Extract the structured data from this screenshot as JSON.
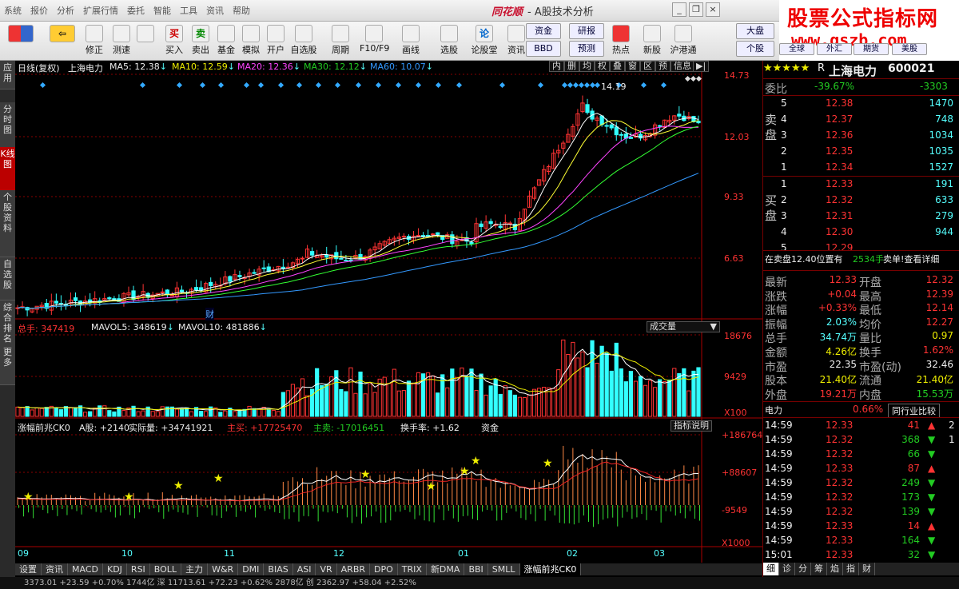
{
  "menu": [
    "系统",
    "报价",
    "分析",
    "扩展行情",
    "委托",
    "智能",
    "工具",
    "资讯",
    "帮助"
  ],
  "app": {
    "logo": "同花顺",
    "title": "- A股技术分析"
  },
  "brand": {
    "line1": "股票公式指标网",
    "line2": "www.gszb.com"
  },
  "toolbar": [
    {
      "label": "",
      "icon": "grid-icon"
    },
    {
      "label": "",
      "icon": "back-arrow-icon"
    },
    {
      "label": "修正",
      "icon": "up-down-icon"
    },
    {
      "label": "测速",
      "icon": "gauge-icon"
    },
    {
      "label": "",
      "icon": "clock-icon"
    },
    {
      "label": "买入",
      "icon": "buy-icon",
      "glyph": "买"
    },
    {
      "label": "卖出",
      "icon": "sell-icon",
      "glyph": "卖"
    },
    {
      "label": "基金",
      "icon": "fund-icon"
    },
    {
      "label": "模拟",
      "icon": "hammer-icon"
    },
    {
      "label": "开户",
      "icon": "lock-icon"
    },
    {
      "label": "自选股",
      "icon": "star-icon"
    },
    {
      "label": "周期",
      "icon": "period-icon"
    },
    {
      "label": "F10/F9",
      "icon": "f10-icon"
    },
    {
      "label": "画线",
      "icon": "pen-icon"
    },
    {
      "label": "选股",
      "icon": "screen-icon"
    },
    {
      "label": "论股堂",
      "icon": "lun-icon",
      "glyph": "论"
    },
    {
      "label": "资讯",
      "icon": "doc-icon"
    },
    {
      "label": "热点",
      "icon": "hot-icon"
    },
    {
      "label": "新股",
      "icon": "newstock-icon"
    },
    {
      "label": "沪港通",
      "icon": "ssehk-icon"
    }
  ],
  "toolbar_btns": [
    "资金",
    "研报",
    "BBD",
    "预测",
    "大盘",
    "个股",
    "全球",
    "外汇",
    "期货",
    "美股"
  ],
  "sidebar": [
    "应用",
    "分时图",
    "K线图",
    "个股资料",
    "自选股",
    "综合排名",
    "更多"
  ],
  "kline": {
    "header": "日线(复权)",
    "name": "上海电力",
    "ma5": "MA5: 12.38",
    "ma10": "MA10: 12.59",
    "ma20": "MA20: 12.36",
    "ma30": "MA30: 12.12",
    "ma60": "MA60: 10.07",
    "peak": "14.19",
    "cai": "财",
    "yaxis": [
      "14.73",
      "12.03",
      "9.33",
      "6.63"
    ],
    "tabs": [
      "内",
      "删",
      "均",
      "权",
      "叠",
      "窗",
      "区",
      "预",
      "信息"
    ]
  },
  "vol": {
    "total": "总手: 347419",
    "mavol5": "MAVOL5: 348619",
    "mavol10": "MAVOL10: 481886",
    "dropdown": "成交量",
    "yaxis": [
      "18676",
      "9429",
      "X100"
    ]
  },
  "ind": {
    "name": "涨幅前兆CK0",
    "ashare": "A股: +2140",
    "real": "实际量: +34741921",
    "mainbuy": "主买: +17725470",
    "mainsell": "主卖: -17016451",
    "turnover": "换手率: +1.62",
    "fund": "资金",
    "btn": "指标说明",
    "yaxis": [
      "+186764",
      "+88607",
      "-9549",
      "X1000"
    ]
  },
  "xaxis": [
    "09",
    "10",
    "11",
    "12",
    "01",
    "02",
    "03"
  ],
  "bottom_tabs": [
    "设置",
    "资讯",
    "MACD",
    "KDJ",
    "RSI",
    "BOLL",
    "主力",
    "W&R",
    "DMI",
    "BIAS",
    "ASI",
    "VR",
    "ARBR",
    "DPO",
    "TRIX",
    "新DMA",
    "BBI",
    "SMLL",
    "涨幅前兆CK0"
  ],
  "status": "3373.01  +23.59  +0.70%  1744亿  深  11713.61  +72.23  +0.62%  2878亿  创  2362.97  +58.04  +2.52%",
  "quote": {
    "stars": "★★★★★",
    "r": "R",
    "name": "上海电力",
    "code": "600021",
    "weibi_lbl": "委比",
    "weibi": "-39.67%",
    "weicha": "-3303",
    "sell_lbl": "卖盘",
    "buy_lbl": "买盘",
    "sell": [
      {
        "n": "5",
        "p": "12.38",
        "v": "1470"
      },
      {
        "n": "4",
        "p": "12.37",
        "v": "748"
      },
      {
        "n": "3",
        "p": "12.36",
        "v": "1034"
      },
      {
        "n": "2",
        "p": "12.35",
        "v": "1035"
      },
      {
        "n": "1",
        "p": "12.34",
        "v": "1527"
      }
    ],
    "buy": [
      {
        "n": "1",
        "p": "12.33",
        "v": "191"
      },
      {
        "n": "2",
        "p": "12.32",
        "v": "633"
      },
      {
        "n": "3",
        "p": "12.31",
        "v": "279"
      },
      {
        "n": "4",
        "p": "12.30",
        "v": "944"
      },
      {
        "n": "5",
        "p": "12.29",
        "v": ""
      }
    ],
    "notice": "在卖盘12.40位置有",
    "notice_v": "2534手",
    "notice_link": "卖单!查看详细",
    "stats": [
      [
        "最新",
        "12.33",
        "开盘",
        "12.32"
      ],
      [
        "涨跌",
        "+0.04",
        "最高",
        "12.39"
      ],
      [
        "涨幅",
        "+0.33%",
        "最低",
        "12.14"
      ],
      [
        "振幅",
        "2.03%",
        "均价",
        "12.27"
      ],
      [
        "总手",
        "34.74万",
        "量比",
        "0.97"
      ],
      [
        "金额",
        "4.26亿",
        "换手",
        "1.62%"
      ],
      [
        "市盈",
        "22.35",
        "市盈(动)",
        "32.46"
      ],
      [
        "股本",
        "21.40亿",
        "流通",
        "21.40亿"
      ],
      [
        "外盘",
        "19.21万",
        "内盘",
        "15.53万"
      ]
    ],
    "sector": "电力",
    "sector_pct": "0.66%",
    "compare": "同行业比较",
    "ticks": [
      [
        "14:59",
        "12.33",
        "41",
        "up",
        "2"
      ],
      [
        "14:59",
        "12.32",
        "368",
        "down",
        "1"
      ],
      [
        "14:59",
        "12.32",
        "66",
        "down",
        ""
      ],
      [
        "14:59",
        "12.33",
        "87",
        "up",
        ""
      ],
      [
        "14:59",
        "12.32",
        "249",
        "down",
        ""
      ],
      [
        "14:59",
        "12.32",
        "173",
        "down",
        ""
      ],
      [
        "14:59",
        "12.32",
        "139",
        "down",
        ""
      ],
      [
        "14:59",
        "12.33",
        "14",
        "up",
        ""
      ],
      [
        "14:59",
        "12.33",
        "164",
        "down",
        ""
      ],
      [
        "15:01",
        "12.33",
        "32",
        "down",
        ""
      ]
    ],
    "rtabs": [
      "细",
      "诊",
      "分",
      "筹",
      "焰",
      "指",
      "财"
    ]
  },
  "colors": {
    "up": "#ff3333",
    "down": "#33ffff",
    "ma5": "#ffffff",
    "ma10": "#ffff33",
    "ma20": "#ff44ff",
    "ma30": "#33ff33",
    "ma60": "#3399ff"
  }
}
